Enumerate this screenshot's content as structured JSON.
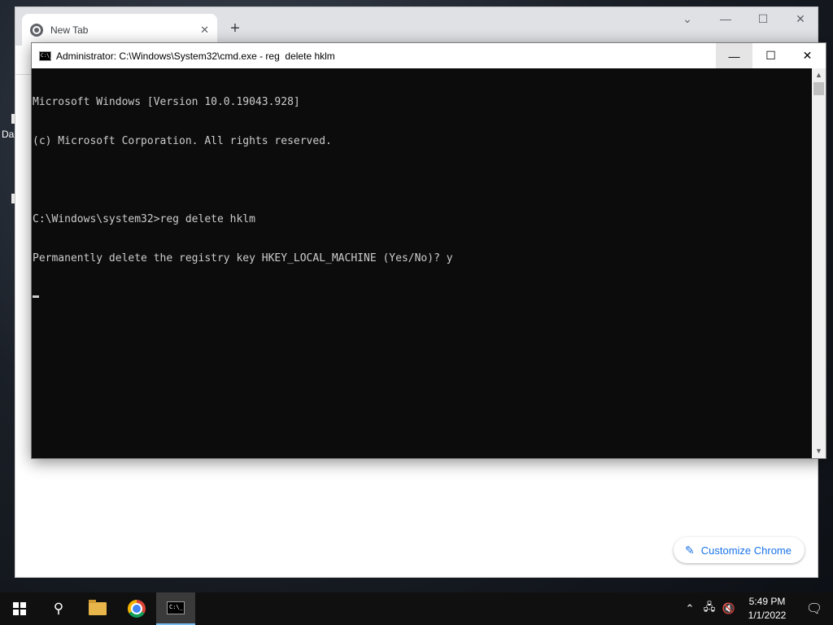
{
  "desktop": {
    "label": "Da"
  },
  "chrome": {
    "tab_title": "New Tab",
    "tab_close": "✕",
    "new_tab": "+",
    "controls": {
      "dropdown": "⌄",
      "minimize": "—",
      "maximize": "☐",
      "close": "✕"
    },
    "customize_label": "Customize Chrome",
    "accent": "#1a73e8"
  },
  "cmd": {
    "title": "Administrator: C:\\Windows\\System32\\cmd.exe - reg  delete hklm",
    "icon_text": "C:\\_",
    "controls": {
      "minimize": "—",
      "maximize": "☐",
      "close": "✕"
    },
    "lines": [
      "Microsoft Windows [Version 10.0.19043.928]",
      "(c) Microsoft Corporation. All rights reserved.",
      "",
      "C:\\Windows\\system32>reg delete hklm",
      "Permanently delete the registry key HKEY_LOCAL_MACHINE (Yes/No)? y"
    ],
    "scroll_up": "▲",
    "scroll_down": "▼"
  },
  "taskbar": {
    "start_icon": "windows-logo-icon",
    "search_icon": "search-icon",
    "apps": [
      "file-explorer-icon",
      "chrome-icon",
      "cmd-icon"
    ],
    "tray": {
      "chevron": "⌃",
      "network": "🖧",
      "volume": "🔇",
      "time": "5:49 PM",
      "date": "1/1/2022",
      "notifications": "🗨"
    }
  }
}
